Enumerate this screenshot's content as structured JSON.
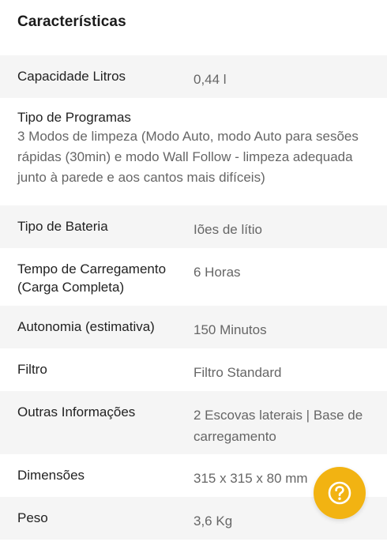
{
  "section": {
    "title": "Características"
  },
  "specs": [
    {
      "label": "Capacidade Litros",
      "value": "0,44 l"
    },
    {
      "label": "Tipo de Programas",
      "value": "3 Modos de limpeza (Modo Auto, modo Auto para sesões rápidas (30min) e modo Wall Follow - limpeza adequada junto à parede e aos cantos mais difíceis)"
    },
    {
      "label": "Tipo de Bateria",
      "value": "Iões de lítio"
    },
    {
      "label": "Tempo de Carregamento (Carga Completa)",
      "value": "6 Horas"
    },
    {
      "label": "Autonomia (estimativa)",
      "value": "150 Minutos"
    },
    {
      "label": "Filtro",
      "value": "Filtro Standard"
    },
    {
      "label": "Outras Informações",
      "value": "2 Escovas laterais | Base de carregamento"
    },
    {
      "label": "Dimensões",
      "value": "315 x 315 x 80 mm"
    },
    {
      "label": "Peso",
      "value": "3,6 Kg"
    }
  ],
  "help_button": {
    "icon": "question-circle-icon",
    "color": "#f2b312"
  },
  "colors": {
    "shaded_row": "#f5f5f5",
    "label_text": "#222222",
    "value_text": "#666666"
  }
}
